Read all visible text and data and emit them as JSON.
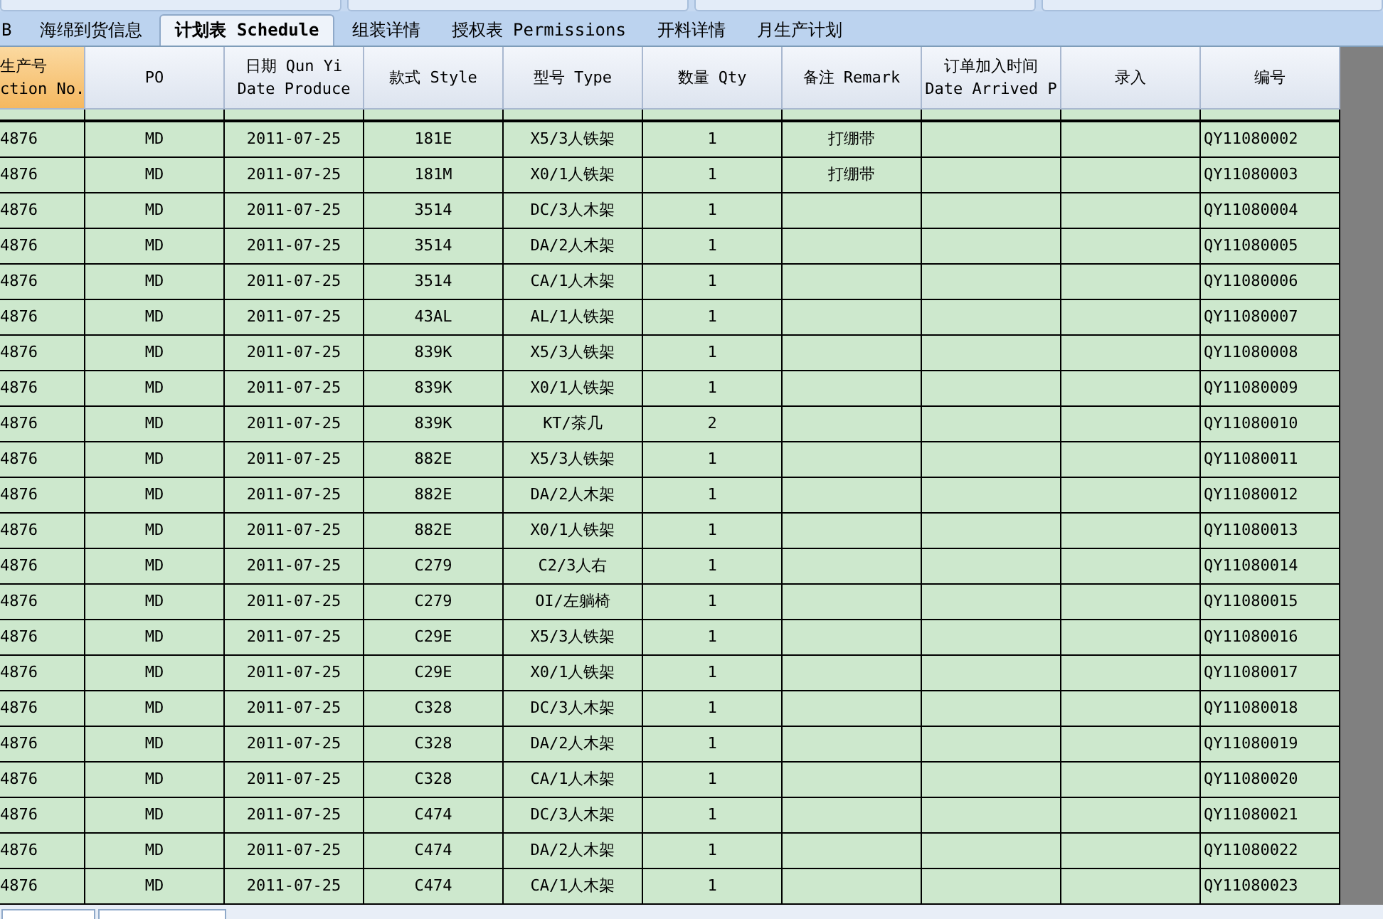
{
  "tabs": [
    {
      "label": "B",
      "selected": false
    },
    {
      "label": "海绵到货信息",
      "selected": false
    },
    {
      "label": "计划表  Schedule",
      "selected": true
    },
    {
      "label": "组装详情",
      "selected": false
    },
    {
      "label": "授权表  Permissions",
      "selected": false
    },
    {
      "label": "开料详情",
      "selected": false
    },
    {
      "label": "月生产计划",
      "selected": false
    }
  ],
  "table": {
    "columns": [
      {
        "lines": [
          "生产号",
          "ction No."
        ],
        "selected": true
      },
      {
        "lines": [
          "PO"
        ],
        "selected": false
      },
      {
        "lines": [
          "日期 Qun Yi",
          "Date Produce"
        ],
        "selected": false
      },
      {
        "lines": [
          "款式 Style"
        ],
        "selected": false
      },
      {
        "lines": [
          "型号 Type"
        ],
        "selected": false
      },
      {
        "lines": [
          "数量 Qty"
        ],
        "selected": false
      },
      {
        "lines": [
          "备注 Remark"
        ],
        "selected": false
      },
      {
        "lines": [
          "订单加入时间",
          "Date Arrived P"
        ],
        "selected": false
      },
      {
        "lines": [
          "录入"
        ],
        "selected": false
      },
      {
        "lines": [
          "编号"
        ],
        "selected": false
      }
    ],
    "rows": [
      [
        "4876",
        "MD",
        "2011-07-25",
        "181E",
        "X5/3人铁架",
        "1",
        "打绷带",
        null,
        null,
        "QY11080002"
      ],
      [
        "4876",
        "MD",
        "2011-07-25",
        "181M",
        "X0/1人铁架",
        "1",
        "打绷带",
        null,
        null,
        "QY11080003"
      ],
      [
        "4876",
        "MD",
        "2011-07-25",
        "3514",
        "DC/3人木架",
        "1",
        null,
        null,
        null,
        "QY11080004"
      ],
      [
        "4876",
        "MD",
        "2011-07-25",
        "3514",
        "DA/2人木架",
        "1",
        null,
        null,
        null,
        "QY11080005"
      ],
      [
        "4876",
        "MD",
        "2011-07-25",
        "3514",
        "CA/1人木架",
        "1",
        null,
        null,
        null,
        "QY11080006"
      ],
      [
        "4876",
        "MD",
        "2011-07-25",
        "43AL",
        "AL/1人铁架",
        "1",
        null,
        null,
        null,
        "QY11080007"
      ],
      [
        "4876",
        "MD",
        "2011-07-25",
        "839K",
        "X5/3人铁架",
        "1",
        null,
        null,
        null,
        "QY11080008"
      ],
      [
        "4876",
        "MD",
        "2011-07-25",
        "839K",
        "X0/1人铁架",
        "1",
        null,
        null,
        null,
        "QY11080009"
      ],
      [
        "4876",
        "MD",
        "2011-07-25",
        "839K",
        "KT/茶几",
        "2",
        null,
        null,
        null,
        "QY11080010"
      ],
      [
        "4876",
        "MD",
        "2011-07-25",
        "882E",
        "X5/3人铁架",
        "1",
        null,
        null,
        null,
        "QY11080011"
      ],
      [
        "4876",
        "MD",
        "2011-07-25",
        "882E",
        "DA/2人木架",
        "1",
        null,
        null,
        null,
        "QY11080012"
      ],
      [
        "4876",
        "MD",
        "2011-07-25",
        "882E",
        "X0/1人铁架",
        "1",
        null,
        null,
        null,
        "QY11080013"
      ],
      [
        "4876",
        "MD",
        "2011-07-25",
        "C279",
        "C2/3人右",
        "1",
        null,
        null,
        null,
        "QY11080014"
      ],
      [
        "4876",
        "MD",
        "2011-07-25",
        "C279",
        "OI/左躺椅",
        "1",
        null,
        null,
        null,
        "QY11080015"
      ],
      [
        "4876",
        "MD",
        "2011-07-25",
        "C29E",
        "X5/3人铁架",
        "1",
        null,
        null,
        null,
        "QY11080016"
      ],
      [
        "4876",
        "MD",
        "2011-07-25",
        "C29E",
        "X0/1人铁架",
        "1",
        null,
        null,
        null,
        "QY11080017"
      ],
      [
        "4876",
        "MD",
        "2011-07-25",
        "C328",
        "DC/3人木架",
        "1",
        null,
        null,
        null,
        "QY11080018"
      ],
      [
        "4876",
        "MD",
        "2011-07-25",
        "C328",
        "DA/2人木架",
        "1",
        null,
        null,
        null,
        "QY11080019"
      ],
      [
        "4876",
        "MD",
        "2011-07-25",
        "C328",
        "CA/1人木架",
        "1",
        null,
        null,
        null,
        "QY11080020"
      ],
      [
        "4876",
        "MD",
        "2011-07-25",
        "C474",
        "DC/3人木架",
        "1",
        null,
        null,
        null,
        "QY11080021"
      ],
      [
        "4876",
        "MD",
        "2011-07-25",
        "C474",
        "DA/2人木架",
        "1",
        null,
        null,
        null,
        "QY11080022"
      ],
      [
        "4876",
        "MD",
        "2011-07-25",
        "C474",
        "CA/1人木架",
        "1",
        null,
        null,
        null,
        "QY11080023"
      ]
    ]
  }
}
